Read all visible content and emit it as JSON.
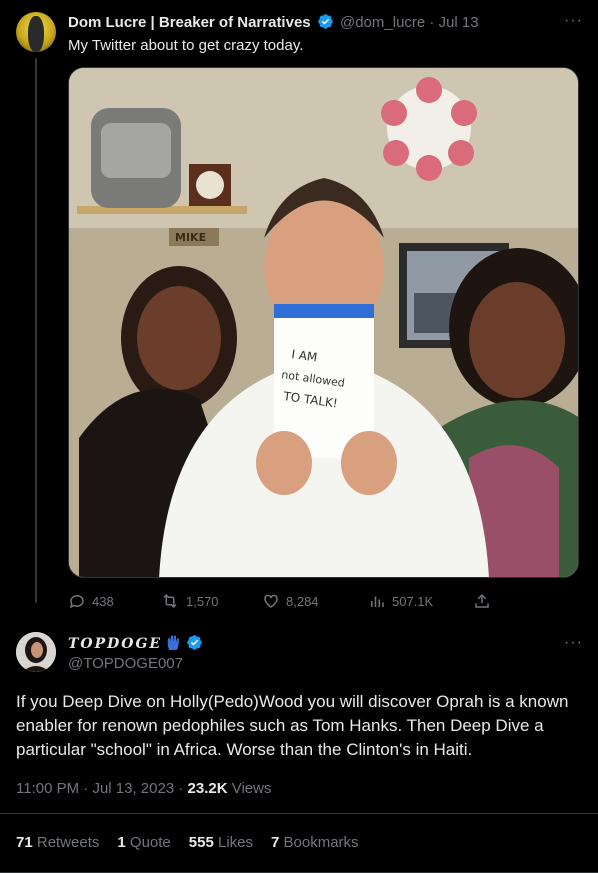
{
  "quoted": {
    "name": "Dom Lucre | Breaker of Narratives",
    "handle": "@dom_lucre",
    "sep": "·",
    "date": "Jul 13",
    "text": "My Twitter about to get crazy today.",
    "photo_sign_text": [
      "I AM",
      "not allowed",
      "TO TALK!"
    ],
    "shelf_sign": "MIKE",
    "actions": {
      "replies": "438",
      "retweets": "1,570",
      "likes": "8,284",
      "views": "507.1K"
    }
  },
  "main": {
    "name": "TOPDOGE",
    "handle": "@TOPDOGE007",
    "text": "If you Deep Dive on Holly(Pedo)Wood you will discover Oprah is a known enabler for renown pedophiles such as Tom Hanks. Then Deep Dive a particular \"school\" in Africa. Worse than the Clinton's in Haiti.",
    "time": "11:00 PM",
    "date": "Jul 13, 2023",
    "views_count": "23.2K",
    "views_label": "Views",
    "stats": {
      "retweets_count": "71",
      "retweets_label": "Retweets",
      "quotes_count": "1",
      "quotes_label": "Quote",
      "likes_count": "555",
      "likes_label": "Likes",
      "bookmarks_count": "7",
      "bookmarks_label": "Bookmarks"
    }
  },
  "colors": {
    "background": "#000000",
    "text": "#e7e9ea",
    "muted": "#71767b",
    "verified": "#1d9bf0",
    "divider": "#2f3336"
  }
}
